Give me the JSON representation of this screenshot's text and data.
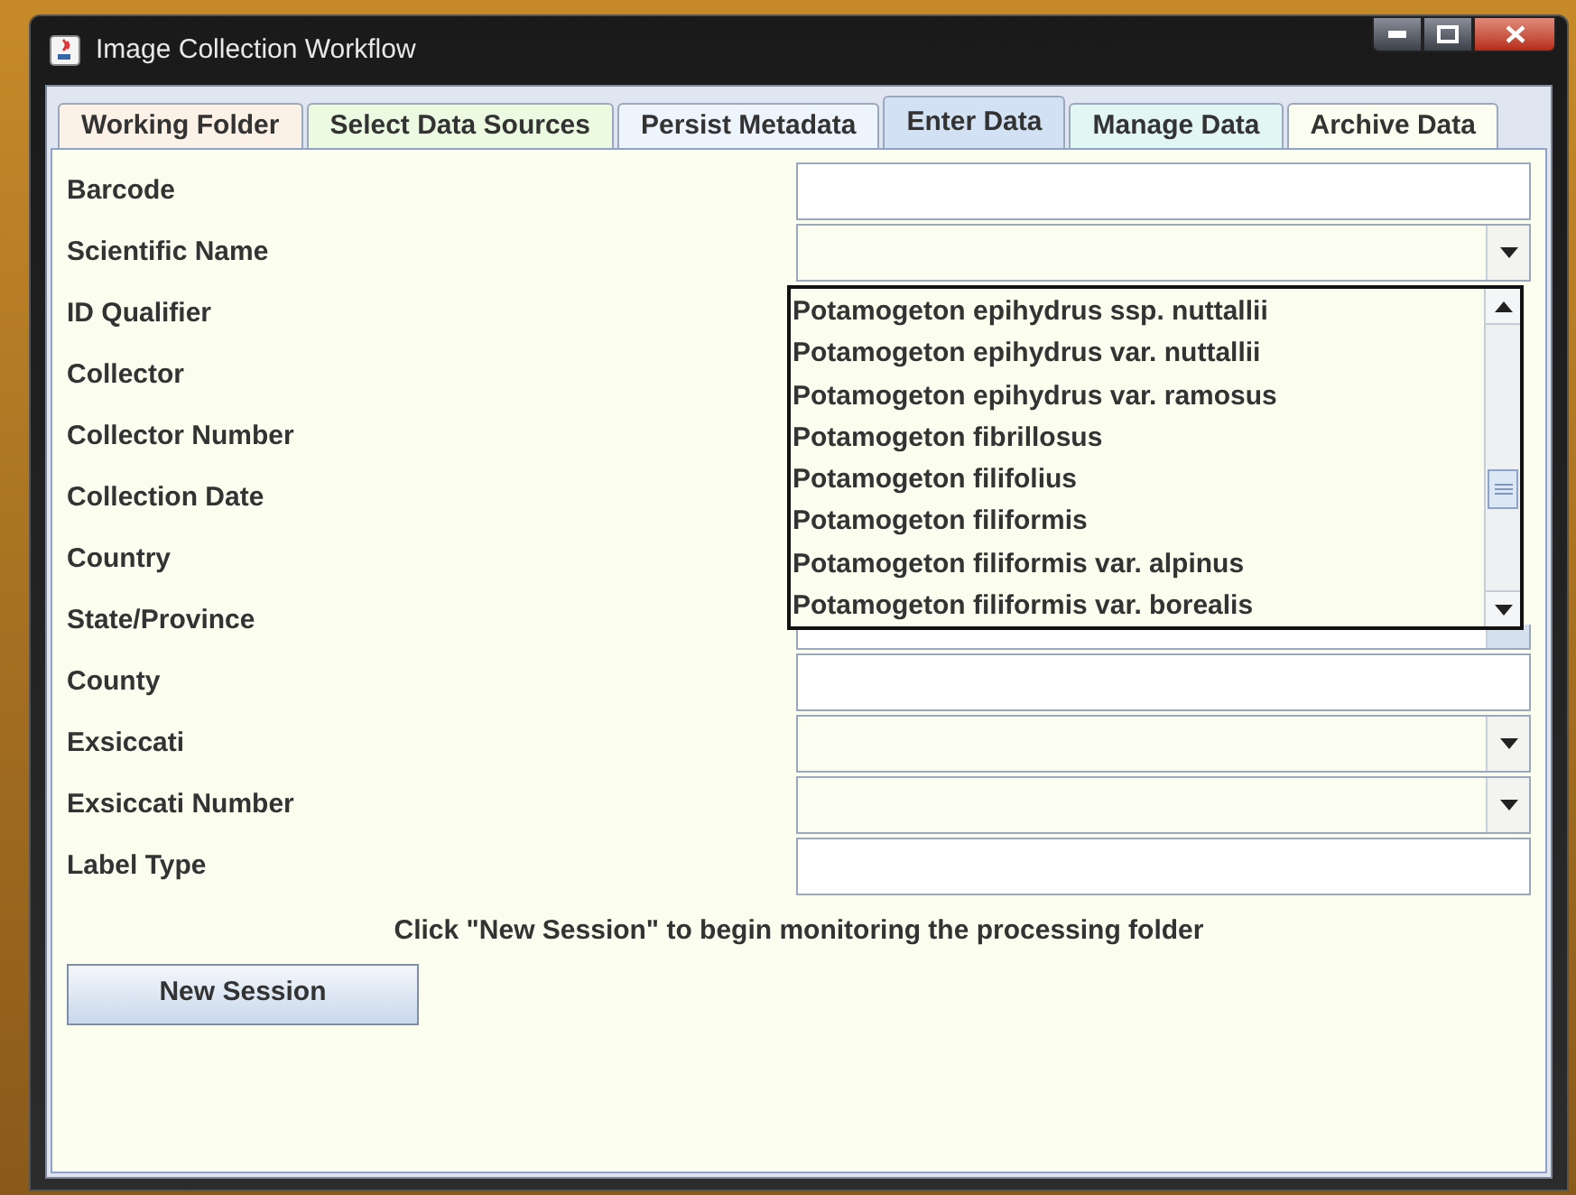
{
  "window": {
    "title": "Image Collection Workflow"
  },
  "tabs": [
    {
      "label": "Working Folder",
      "selected": false,
      "color": "#fbf1e6"
    },
    {
      "label": "Select Data Sources",
      "selected": false,
      "color": "#ecfae2"
    },
    {
      "label": "Persist Metadata",
      "selected": false,
      "color": "#eef4fc"
    },
    {
      "label": "Enter Data",
      "selected": true,
      "color": "#d3e1f4"
    },
    {
      "label": "Manage Data",
      "selected": false,
      "color": "#e2f6f4"
    },
    {
      "label": "Archive Data",
      "selected": false,
      "color": "#fbfdf0"
    }
  ],
  "fields": [
    {
      "label": "Barcode",
      "kind": "text"
    },
    {
      "label": "Scientific Name",
      "kind": "combo"
    },
    {
      "label": "ID Qualifier",
      "kind": "covered"
    },
    {
      "label": "Collector",
      "kind": "covered"
    },
    {
      "label": "Collector Number",
      "kind": "covered"
    },
    {
      "label": "Collection Date",
      "kind": "covered"
    },
    {
      "label": "Country",
      "kind": "covered"
    },
    {
      "label": "State/Province",
      "kind": "combo-covered"
    },
    {
      "label": "County",
      "kind": "text"
    },
    {
      "label": "Exsiccati",
      "kind": "combo"
    },
    {
      "label": "Exsiccati Number",
      "kind": "combo"
    },
    {
      "label": "Label Type",
      "kind": "text"
    }
  ],
  "dropdown": {
    "options": [
      "Potamogeton epihydrus ssp. nuttallii",
      "Potamogeton epihydrus var. nuttallii",
      "Potamogeton epihydrus var. ramosus",
      "Potamogeton fibrillosus",
      "Potamogeton filifolius",
      "Potamogeton filiformis",
      "Potamogeton filiformis var. alpinus",
      "Potamogeton filiformis var. borealis"
    ]
  },
  "message": "Click \"New Session\" to begin monitoring the processing folder",
  "button": "New Session"
}
